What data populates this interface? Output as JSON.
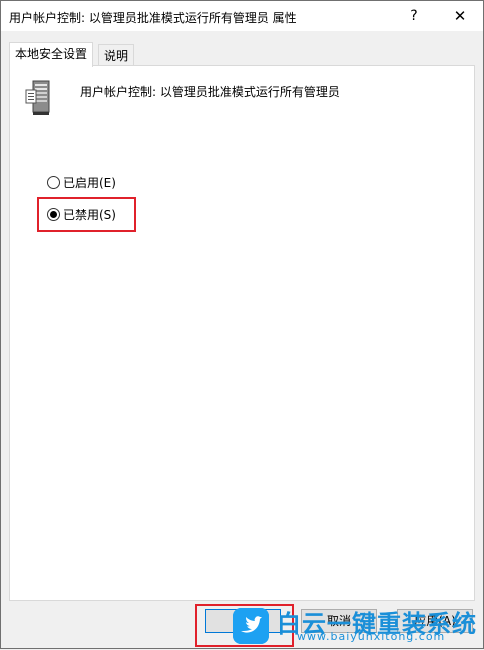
{
  "window": {
    "title": "用户帐户控制: 以管理员批准模式运行所有管理员 属性",
    "help_label": "?",
    "close_label": "✕"
  },
  "tabs": [
    {
      "label": "本地安全设置",
      "active": true
    },
    {
      "label": "说明",
      "active": false
    }
  ],
  "policy": {
    "icon": "server-policy-icon",
    "title": "用户帐户控制: 以管理员批准模式运行所有管理员"
  },
  "options": {
    "enabled_label": "已启用(E)",
    "disabled_label": "已禁用(S)",
    "selected": "disabled"
  },
  "buttons": {
    "ok": "",
    "cancel": "取消",
    "apply": "应用(A)"
  },
  "watermark": {
    "brand": "白云一键重装系统",
    "url": "www.baiyunxitong.com"
  },
  "colors": {
    "highlight": "#e0212b",
    "watermark": "#1a8fd8"
  }
}
